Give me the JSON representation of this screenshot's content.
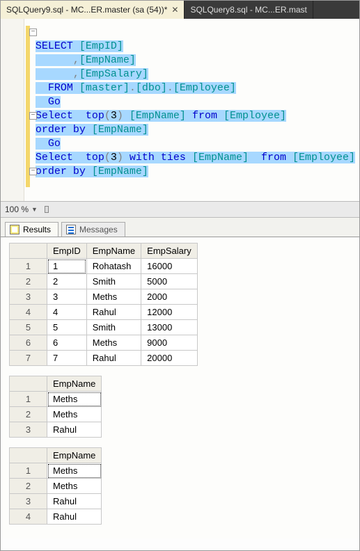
{
  "tabs": {
    "active": "SQLQuery9.sql - MC...ER.master (sa (54))*",
    "inactive": "SQLQuery8.sql - MC...ER.mast"
  },
  "code": {
    "l1a": "SELECT",
    "l1b": " [EmpID]",
    "l2a": "      ,",
    "l2b": "[EmpName]",
    "l3a": "      ,",
    "l3b": "[EmpSalary]",
    "l4a": "  FROM",
    "l4b": " [master]",
    "l4c": ".",
    "l4d": "[dbo]",
    "l4e": ".",
    "l4f": "[Employee]",
    "l5a": "  Go",
    "l6a": "Select  top",
    "l6b": "(",
    "l6c": "3",
    "l6d": ")",
    "l6e": " [EmpName]",
    "l6f": " from",
    "l6g": " [Employee]",
    "l7a": "order by",
    "l7b": " [EmpName]",
    "l8a": "  Go",
    "l9a": "Select  top",
    "l9b": "(",
    "l9c": "3",
    "l9d": ")",
    "l9e": " with ties",
    "l9f": " [EmpName]",
    "l9g": "  from",
    "l9h": " [Employee]",
    "l10a": "order by",
    "l10b": " [EmpName]"
  },
  "zoom": "100 %",
  "rtabs": {
    "results": "Results",
    "messages": "Messages"
  },
  "grid1": {
    "headers": [
      "EmpID",
      "EmpName",
      "EmpSalary"
    ],
    "rows": [
      [
        "1",
        "Rohatash",
        "16000"
      ],
      [
        "2",
        "Smith",
        "5000"
      ],
      [
        "3",
        "Meths",
        "2000"
      ],
      [
        "4",
        "Rahul",
        "12000"
      ],
      [
        "5",
        "Smith",
        "13000"
      ],
      [
        "6",
        "Meths",
        "9000"
      ],
      [
        "7",
        "Rahul",
        "20000"
      ]
    ]
  },
  "grid2": {
    "headers": [
      "EmpName"
    ],
    "rows": [
      [
        "Meths"
      ],
      [
        "Meths"
      ],
      [
        "Rahul"
      ]
    ]
  },
  "grid3": {
    "headers": [
      "EmpName"
    ],
    "rows": [
      [
        "Meths"
      ],
      [
        "Meths"
      ],
      [
        "Rahul"
      ],
      [
        "Rahul"
      ]
    ]
  }
}
